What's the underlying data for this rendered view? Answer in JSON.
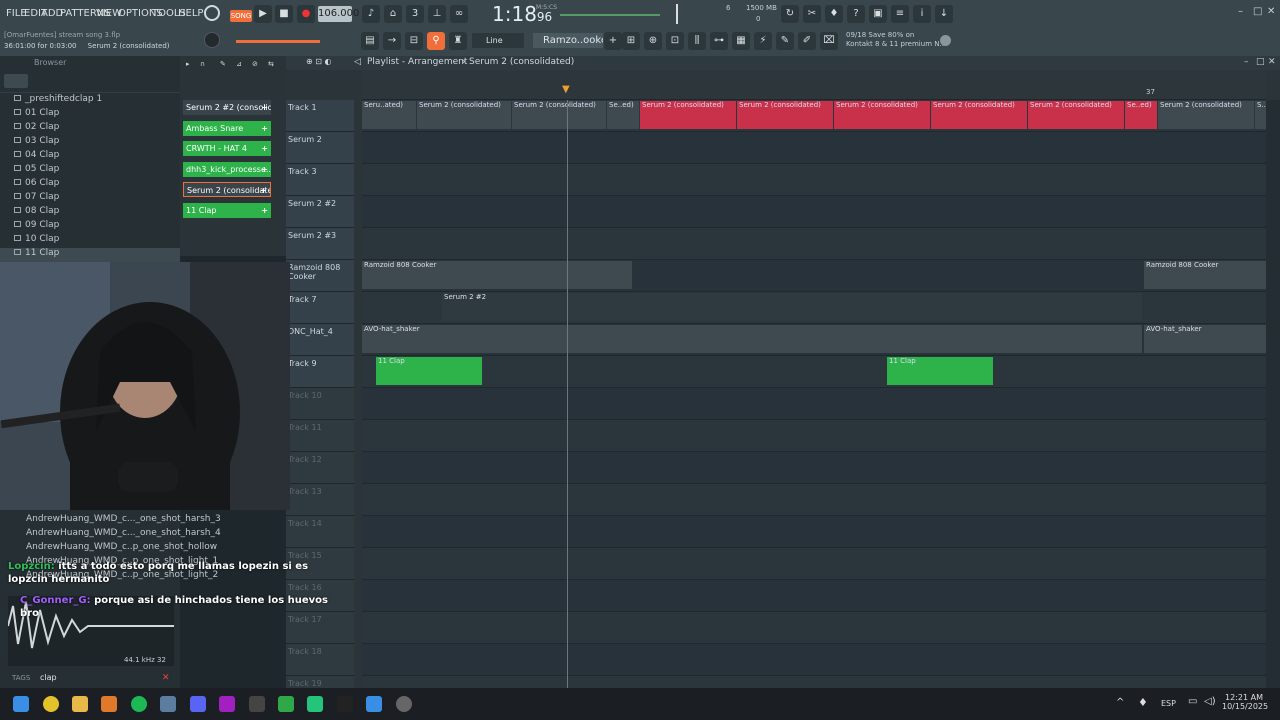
{
  "menu": [
    "FILE",
    "EDIT",
    "ADD",
    "PATTERNS",
    "VIEW",
    "OPTIONS",
    "TOOLS",
    "HELP"
  ],
  "transport": {
    "mode": "SONG",
    "tempo": "106.000",
    "time": "1:18",
    "time_small": "96",
    "cpu_label": "MEM",
    "cpu": "6",
    "ram": "1500 MB",
    "voices": "0"
  },
  "project": {
    "user": "[OmarFuentes]",
    "name": "stream song 3.flp",
    "status": "36:01:00 for 0:03:00",
    "selected": "Serum 2 (consolidated)"
  },
  "snap": "Line",
  "pattern_name": "Ramzo..ooker",
  "hint": {
    "line1": "09/18  Save 80% on",
    "line2": "Kontakt 8 & 11 premium N.."
  },
  "browser": {
    "title": "Browser",
    "items": [
      "_preshiftedclap 1",
      "01 Clap",
      "02 Clap",
      "03 Clap",
      "04 Clap",
      "05 Clap",
      "06 Clap",
      "07 Clap",
      "08 Clap",
      "09 Clap",
      "10 Clap",
      "11 Clap"
    ],
    "files": [
      "AndrewHuang_WMD_c..._one_shot_harsh_3",
      "AndrewHuang_WMD_c..._one_shot_harsh_4",
      "AndrewHuang_WMD_c..p_one_shot_hollow",
      "AndrewHuang_WMD_c..p_one_shot_light_1",
      "AndrewHuang_WMD_c..p_one_shot_light_2"
    ],
    "sample_info": "44.1 kHz 32",
    "tags_label": "TAGS",
    "tags_value": "clap"
  },
  "channels": [
    "Serum 2 #2 (consolid...",
    "Ambass Snare",
    "CRWTH - HAT 4",
    "dhh3_kick_processe...",
    "Serum 2 (consolidate...",
    "11 Clap"
  ],
  "playlist": {
    "title": "Playlist - Arrangement",
    "pattern": "Serum 2 (consolidated)",
    "bar37": "37",
    "tracks": [
      "Track 1",
      "Serum 2",
      "Track 3",
      "Serum 2 #2",
      "Serum 2 #3",
      "Ramzoid 808 Cooker",
      "Track 7",
      "DNC_Hat_4",
      "Track 9",
      "Track 10",
      "Track 11",
      "Track 12",
      "Track 13",
      "Track 14",
      "Track 15",
      "Track 16",
      "Track 17",
      "Track 18",
      "Track 19"
    ],
    "clips": {
      "t1": [
        "Seru..ated)",
        "Serum 2 (consolidated)",
        "Serum 2 (consolidated)",
        "Se..ed)",
        "Serum 2 (consolidated)",
        "Serum 2 (consolidated)",
        "Serum 2 (consolidated)",
        "Serum 2 (consolidated)",
        "Serum 2 (consolidated)",
        "Se..ed)",
        "Serum 2 (consolidated)",
        "S..ed"
      ],
      "r808": "Ramzoid 808 Cooker",
      "t7": "Serum 2 #2",
      "hat": "AVO-hat_shaker",
      "clap": "11 Clap"
    }
  },
  "chat": [
    {
      "user": "Lopzcin:",
      "msg": "itts a todo esto porq me llamas lopezin si es lopzcin hermanito"
    },
    {
      "user": "C_Gonner_G:",
      "msg": "porque asi de hinchados tiene los huevos bro"
    }
  ],
  "taskbar": {
    "lang": "ESP",
    "time": "12:21 AM",
    "date": "10/15/2025"
  },
  "colors": {
    "accent": "#f06e3a",
    "clip_red": "#c9304a",
    "clip_green": "#2db34a"
  }
}
